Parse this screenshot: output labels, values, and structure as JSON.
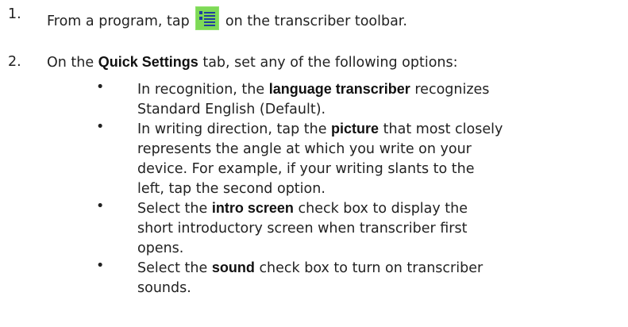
{
  "steps": [
    {
      "number": "1.",
      "text_before": "From a program, tap",
      "icon": "transcriber-options-icon",
      "text_after": "on the transcriber toolbar."
    },
    {
      "number": "2.",
      "text_before": "On the",
      "bold": "Quick Settings",
      "text_after": "tab, set any of the following options:"
    }
  ],
  "bullet_symbol": "•",
  "bullets": [
    {
      "line1_before": "In recognition, the",
      "line1_bold": "language transcriber",
      "line1_after": "recognizes",
      "line2": "Standard English (Default)."
    },
    {
      "line1_before": "In writing direction, tap the",
      "line1_bold": "picture",
      "line1_after": "that most closely",
      "line2": "represents the angle at which you write on your",
      "line3": "device. For example, if your writing slants to the",
      "line4": "left, tap the second option."
    },
    {
      "line1_before": "Select the",
      "line1_bold": "intro screen",
      "line1_after": "check box to display the",
      "line2": "short introductory screen when transcriber first",
      "line3": "opens."
    },
    {
      "line1_before": "Select the",
      "line1_bold": "sound",
      "line1_after": "check box to turn on transcriber",
      "line2": "sounds."
    }
  ],
  "colors": {
    "text": "#222222",
    "icon_green": "#7ed957",
    "icon_blue": "#1f3f9e"
  }
}
